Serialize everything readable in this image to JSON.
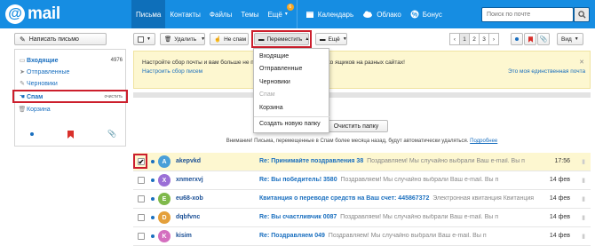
{
  "logo": {
    "at": "@",
    "text": "mail"
  },
  "topnav": {
    "items": [
      {
        "label": "Письма"
      },
      {
        "label": "Контакты"
      },
      {
        "label": "Файлы"
      },
      {
        "label": "Темы"
      },
      {
        "label": "Ещё",
        "badge": "6"
      }
    ],
    "services": [
      {
        "label": "Календарь",
        "icon": "calendar-icon"
      },
      {
        "label": "Облако",
        "icon": "cloud-icon"
      },
      {
        "label": "Бонус",
        "icon": "percent-icon"
      }
    ]
  },
  "search": {
    "placeholder": "Поиск по почте"
  },
  "compose": {
    "label": "Написать письмо"
  },
  "folders": [
    {
      "label": "Входящие",
      "count": "4976"
    },
    {
      "label": "Отправленные"
    },
    {
      "label": "Черновики"
    },
    {
      "label": "Спам",
      "action": "очистить"
    },
    {
      "label": "Корзина"
    }
  ],
  "toolbar": {
    "delete": "Удалить",
    "not_spam": "Не спам",
    "move": "Переместить",
    "more": "Ещё",
    "view": "Вид"
  },
  "pager": {
    "pages": [
      "1",
      "2",
      "3"
    ]
  },
  "notice": {
    "text": "Настройте сбор почты и вам больше не придется проверять несколько ящиков на разных сайтах!",
    "link": "Настроить сбор писем",
    "text2": "",
    "link2": "Это моя единственная почта"
  },
  "clear_folder": "Очистить папку",
  "warning": {
    "text": "Внимание! Письма, перемещенные в Спам более месяца назад, будут автоматически удаляться.",
    "link": "Подробнее"
  },
  "move_menu": {
    "items": [
      "Входящие",
      "Отправленные",
      "Черновики",
      "Спам",
      "Корзина"
    ],
    "create": "Создать новую папку"
  },
  "colors": {
    "brand": "#168de2",
    "highlight": "#cc1f2d",
    "notice_bg": "#fdf7d0"
  },
  "mails": [
    {
      "avatar": "A",
      "color": "#4a9fd8",
      "from": "akepvkd",
      "subject": "Re: Принимайте поздравления 38",
      "preview": "Поздравляем! Мы случайно выбрали Ваш e-mail. Вы п",
      "date": "17:56",
      "checked": "✔"
    },
    {
      "avatar": "X",
      "color": "#9b6fd6",
      "from": "xnmerxvj",
      "subject": "Re: Вы победитель! 3580",
      "preview": "Поздравляем! Мы случайно выбрали Ваш e-mail. Вы п",
      "date": "14 фев",
      "checked": ""
    },
    {
      "avatar": "E",
      "color": "#7fb94b",
      "from": "eu68-xob",
      "subject": "Квитанция о переводе средств на Ваш счет: 445867372",
      "preview": "Электронная квитанция Квитанция",
      "date": "14 фев",
      "checked": ""
    },
    {
      "avatar": "D",
      "color": "#e4a03b",
      "from": "dqbfvnc",
      "subject": "Re: Вы счастливчик 0087",
      "preview": "Поздравляем! Мы случайно выбрали Ваш e-mail. Вы п",
      "date": "14 фев",
      "checked": ""
    },
    {
      "avatar": "K",
      "color": "#d46fbf",
      "from": "kisim",
      "subject": "Re: Поздравляем 049",
      "preview": "Поздравляем! Мы случайно выбрали Ваш e-mail. Вы п",
      "date": "14 фев",
      "checked": ""
    }
  ]
}
